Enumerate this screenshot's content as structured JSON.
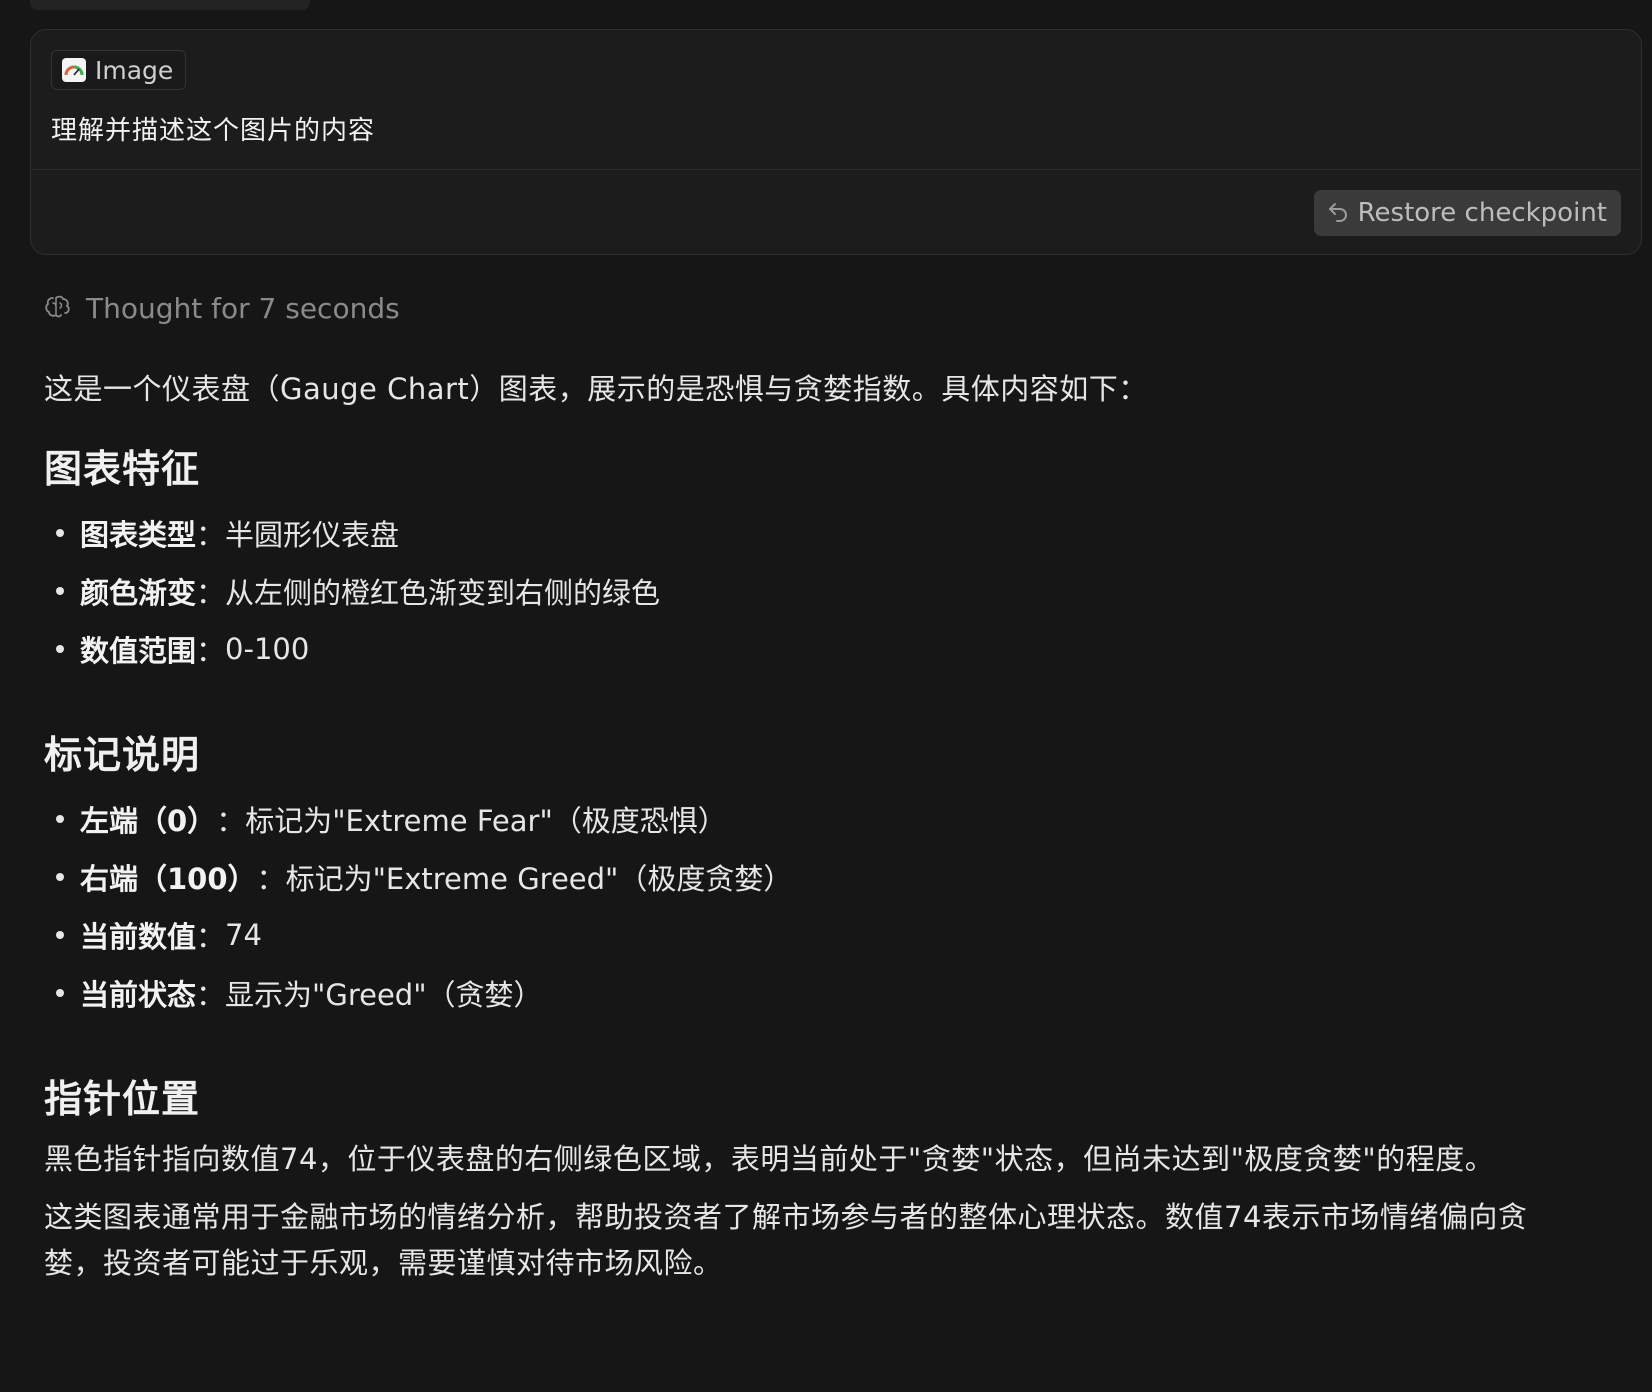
{
  "user_message": {
    "attachment_label": "Image",
    "prompt": "理解并描述这个图片的内容",
    "restore_label": "Restore checkpoint"
  },
  "thought": {
    "label": "Thought for 7 seconds"
  },
  "response": {
    "intro": "这是一个仪表盘（Gauge Chart）图表，展示的是恐惧与贪婪指数。具体内容如下：",
    "sections": [
      {
        "heading": "图表特征",
        "bullets": [
          {
            "key": "图表类型",
            "sep": "：",
            "value": "半圆形仪表盘"
          },
          {
            "key": "颜色渐变",
            "sep": "：",
            "value": "从左侧的橙红色渐变到右侧的绿色"
          },
          {
            "key": "数值范围",
            "sep": "：",
            "value": "0-100"
          }
        ]
      },
      {
        "heading": "标记说明",
        "bullets": [
          {
            "key": "左端（0）",
            "sep": "：",
            "value": "标记为\"Extreme Fear\"（极度恐惧）"
          },
          {
            "key": "右端（100）",
            "sep": "：",
            "value": "标记为\"Extreme Greed\"（极度贪婪）"
          },
          {
            "key": "当前数值",
            "sep": "：",
            "value": "74"
          },
          {
            "key": "当前状态",
            "sep": "：",
            "value": "显示为\"Greed\"（贪婪）"
          }
        ]
      },
      {
        "heading": "指针位置",
        "paragraphs": [
          "黑色指针指向数值74，位于仪表盘的右侧绿色区域，表明当前处于\"贪婪\"状态，但尚未达到\"极度贪婪\"的程度。",
          "这类图表通常用于金融市场的情绪分析，帮助投资者了解市场参与者的整体心理状态。数值74表示市场情绪偏向贪婪，投资者可能过于乐观，需要谨慎对待市场风险。"
        ]
      }
    ]
  },
  "colors": {
    "background": "#161616",
    "card": "#1c1c1c",
    "button": "#3a3a3a",
    "muted_text": "#8a8a8a",
    "text": "#e6e6e6"
  }
}
